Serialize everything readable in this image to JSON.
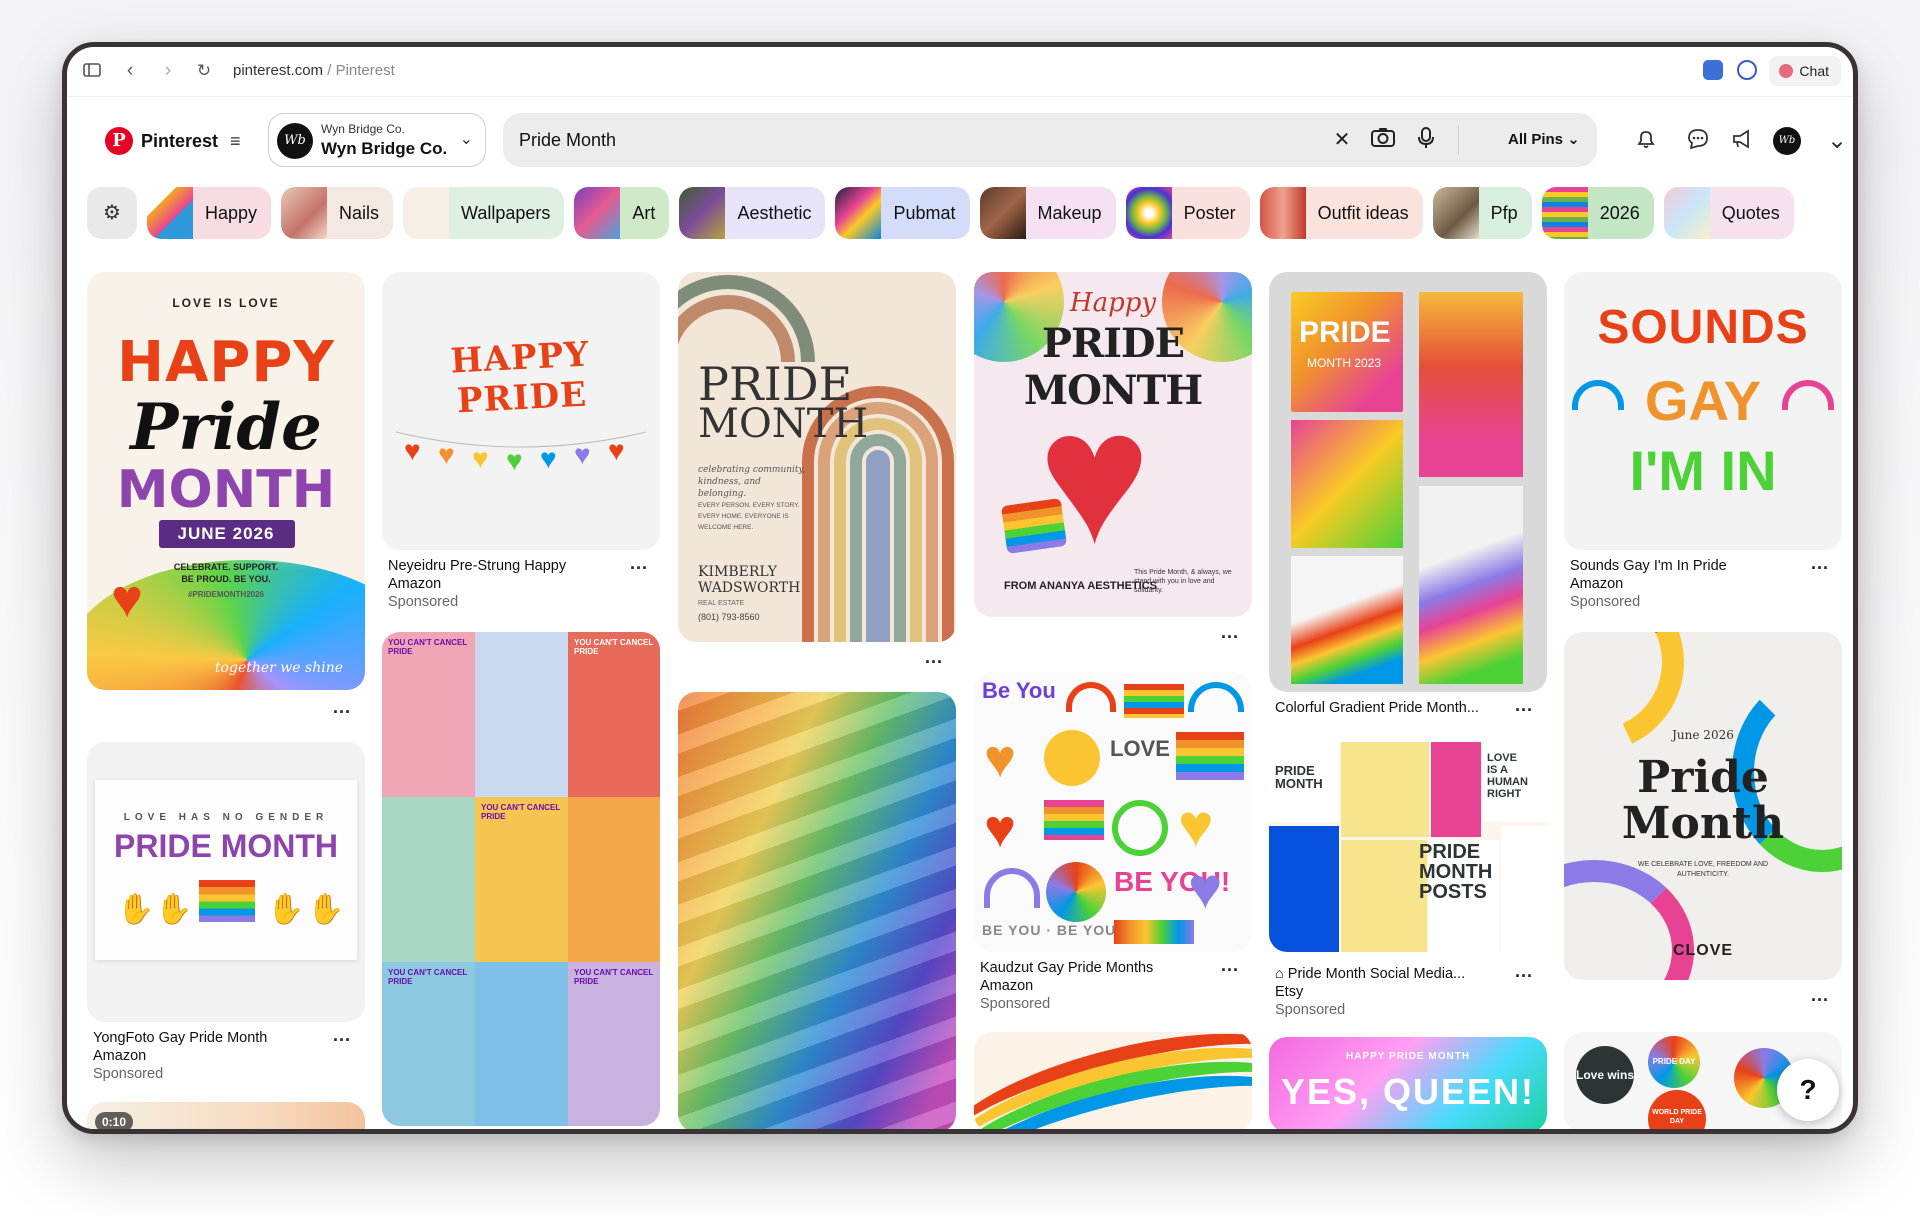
{
  "browser": {
    "url_host": "pinterest.com",
    "url_sep": " / ",
    "url_title": "Pinterest",
    "chat_label": "Chat"
  },
  "header": {
    "brand": "Pinterest",
    "account_small": "Wyn Bridge Co.",
    "account_name": "Wyn Bridge Co.",
    "search_value": "Pride Month",
    "filter_label": "All Pins"
  },
  "chips": [
    {
      "label": "Happy",
      "bg": "#f7dde1"
    },
    {
      "label": "Nails",
      "bg": "#f3e8e2"
    },
    {
      "label": "Wallpapers",
      "bg": "#dff0e3"
    },
    {
      "label": "Art",
      "bg": "#cfe9c9"
    },
    {
      "label": "Aesthetic",
      "bg": "#e7e3f9"
    },
    {
      "label": "Pubmat",
      "bg": "#d3dcf9"
    },
    {
      "label": "Makeup",
      "bg": "#f6e1f4"
    },
    {
      "label": "Poster",
      "bg": "#fbe1de"
    },
    {
      "label": "Outfit ideas",
      "bg": "#fbe3dd"
    },
    {
      "label": "Pfp",
      "bg": "#d9efdd"
    },
    {
      "label": "2026",
      "bg": "#c4e6c4"
    },
    {
      "label": "Quotes",
      "bg": "#f6e2ef"
    }
  ],
  "pins": {
    "p1": {
      "line1": "LOVE IS LOVE",
      "line2": "HAPPY",
      "line3": "Pride",
      "line4": "MONTH",
      "line5": "JUNE 2026",
      "line6": "CELEBRATE. SUPPORT.",
      "line7": "BE PROUD. BE YOU.",
      "line8": "#PRIDEMONTH2026",
      "line9": "together we shine"
    },
    "p2": {
      "art": "HAPPY PRIDE",
      "title": "Neyeidru Pre-Strung Happy",
      "source": "Amazon",
      "sponsored": "Sponsored"
    },
    "p3": {
      "title1": "PRIDE",
      "title2": "MONTH",
      "sub": "celebrating community, kindness, and belonging.",
      "list": "EVERY PERSON. EVERY STORY. EVERY HOME. EVERYONE IS WELCOME HERE.",
      "name": "KIMBERLY WADSWORTH",
      "role": "REAL ESTATE",
      "phone": "(801) 793-8560"
    },
    "p4": {
      "script": "Happy",
      "title": "PRIDE MONTH",
      "footer": "FROM ANANYA AESTHETICS",
      "note": "This Pride Month, & always, we stand with you in love and solidarity."
    },
    "p5": {
      "a": "PRIDE",
      "b": "MONTH 2023",
      "caption": "Colorful Gradient Pride Month..."
    },
    "p6": {
      "art1": "SOUNDS",
      "art2": "GAY",
      "art3": "I'M IN",
      "title": "Sounds Gay I'm In Pride",
      "source": "Amazon",
      "sponsored": "Sponsored"
    },
    "p7": {
      "top": "LOVE HAS NO GENDER",
      "art": "PRIDE MONTH",
      "title": "YongFoto Gay Pride Month",
      "source": "Amazon",
      "sponsored": "Sponsored"
    },
    "p8": {
      "tag": "YOU CAN'T CANCEL PRIDE"
    },
    "p10": {
      "title": "Kaudzut Gay Pride Months",
      "source": "Amazon",
      "sponsored": "Sponsored"
    },
    "p11": {
      "title": "Pride Month Social Media...",
      "source": "Etsy",
      "sponsored": "Sponsored",
      "art": "PRIDE MONTH POSTS"
    },
    "p12": {
      "small": "June 2026",
      "title1": "Pride",
      "title2": "Month",
      "sub": "WE CELEBRATE LOVE, FREEDOM AND AUTHENTICITY.",
      "brand": "CLOVE"
    },
    "p14": {
      "small": "HAPPY PRIDE MONTH",
      "art": "YES, QUEEN!"
    },
    "p15": {
      "a": "Love wins",
      "b": "PRIDE DAY",
      "c": "WORLD PRIDE DAY"
    },
    "video": {
      "time": "0:10"
    },
    "more": "..."
  },
  "icons": [
    "sidebar-icon",
    "back-icon",
    "forward-icon",
    "reload-icon",
    "clear-icon",
    "camera-icon",
    "mic-icon",
    "bell-icon",
    "message-icon",
    "megaphone-icon",
    "chevron-down-icon",
    "help-icon",
    "filter-icon"
  ],
  "colors": {
    "brand": "#e60023"
  }
}
